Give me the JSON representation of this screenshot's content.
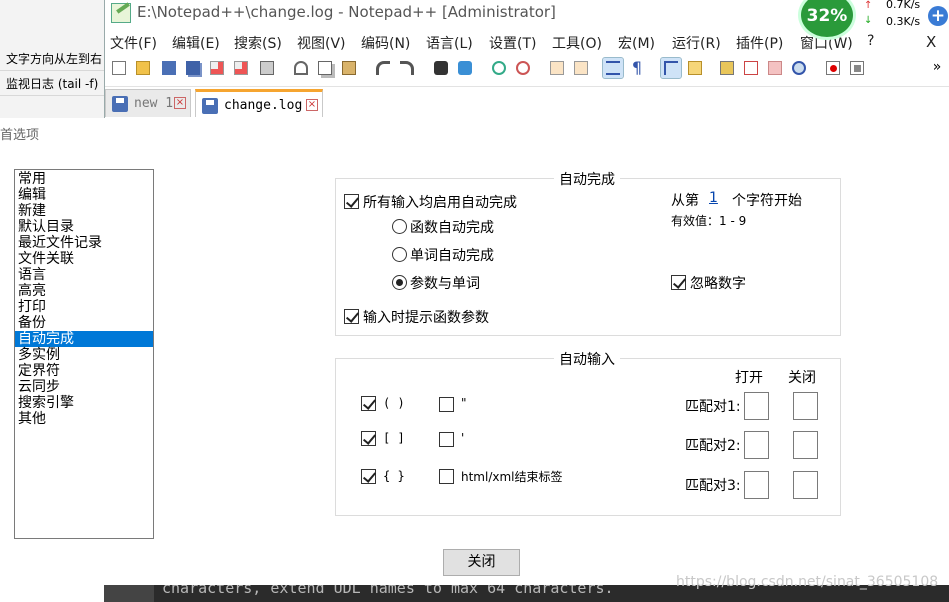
{
  "background_app": {
    "lines": [
      "文字方向从左到右",
      "监视日志 (tail -f)"
    ]
  },
  "window": {
    "title": "E:\\Notepad++\\change.log - Notepad++ [Administrator]",
    "close_glyph": "X"
  },
  "menu": [
    "文件(F)",
    "编辑(E)",
    "搜索(S)",
    "视图(V)",
    "编码(N)",
    "语言(L)",
    "设置(T)",
    "工具(O)",
    "宏(M)",
    "运行(R)",
    "插件(P)",
    "窗口(W)",
    "?"
  ],
  "toolbar": {
    "icons": [
      "new-file-icon",
      "open-file-icon",
      "save-icon",
      "save-all-icon",
      "close-icon",
      "close-all-icon",
      "print-icon",
      "cut-icon",
      "copy-icon",
      "paste-icon",
      "undo-icon",
      "redo-icon",
      "find-icon",
      "replace-icon",
      "zoom-in-icon",
      "zoom-out-icon",
      "sync-vertical-icon",
      "sync-horizontal-icon",
      "word-wrap-icon",
      "show-all-chars-icon",
      "indent-guide-icon",
      "doc-map-icon",
      "function-list-icon",
      "folder-workspace-icon",
      "monitoring-icon",
      "record-macro-icon",
      "stop-macro-icon"
    ],
    "overflow_glyph": "»"
  },
  "tabs": [
    {
      "label": "new 1",
      "active": false
    },
    {
      "label": "change.log",
      "active": true
    }
  ],
  "speed_widget": {
    "percent": "32%",
    "upload": "0.7K/s",
    "download": "0.3K/s",
    "plus": "+",
    "up_glyph": "↑",
    "down_glyph": "↓"
  },
  "dialog": {
    "title": "首选项",
    "categories": [
      "常用",
      "编辑",
      "新建",
      "默认目录",
      "最近文件记录",
      "文件关联",
      "语言",
      "高亮",
      "打印",
      "备份",
      "自动完成",
      "多实例",
      "定界符",
      "云同步",
      "搜索引擎",
      "其他"
    ],
    "selected_category": "自动完成",
    "autocomplete": {
      "legend": "自动完成",
      "enable_label": "所有输入均启用自动完成",
      "enable_checked": true,
      "from_prefix": "从第",
      "from_value": "1",
      "from_suffix": "个字符开始",
      "valid_range": "有效值：1 - 9",
      "radio_function": "函数自动完成",
      "radio_word": "单词自动完成",
      "radio_both": "参数与单词",
      "radio_selected": "参数与单词",
      "ignore_numbers": "忽略数字",
      "ignore_numbers_checked": true,
      "param_hint": "输入时提示函数参数",
      "param_hint_checked": true
    },
    "autoinsert": {
      "legend": "自动输入",
      "open_header": "打开",
      "close_header": "关闭",
      "paren": "( )",
      "bracket": "[ ]",
      "brace": "{ }",
      "dquote": "\"",
      "squote": "'",
      "html_tag": "html/xml结束标签",
      "paren_checked": true,
      "bracket_checked": true,
      "brace_checked": true,
      "dquote_checked": false,
      "squote_checked": false,
      "html_checked": false,
      "pair1": "匹配对1:",
      "pair2": "匹配对2:",
      "pair3": "匹配对3:"
    },
    "close_button": "关闭"
  },
  "editor_peek": "characters, extend UDL names to max 64 characters.",
  "watermark": "https://blog.csdn.net/sinat_36505108"
}
